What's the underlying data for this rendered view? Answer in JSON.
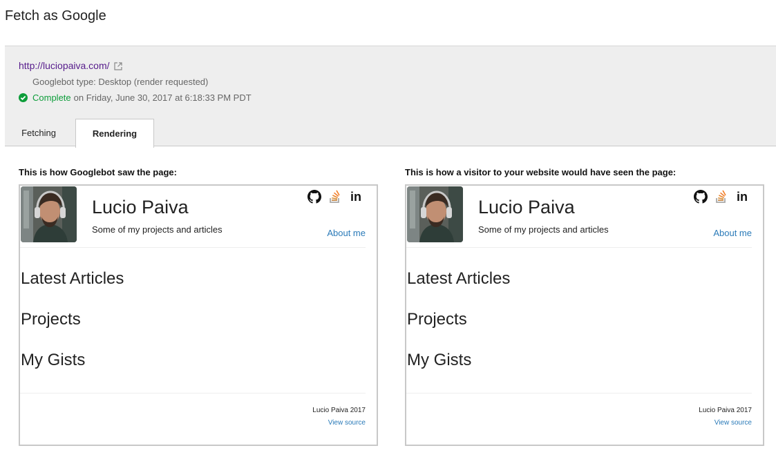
{
  "header": {
    "title": "Fetch as Google"
  },
  "fetch": {
    "url": "http://luciopaiva.com/",
    "bot_type": "Googlebot type: Desktop (render requested)",
    "status": "Complete",
    "status_date": "on Friday, June 30, 2017 at 6:18:33 PM PDT"
  },
  "tabs": [
    {
      "label": "Fetching",
      "active": false
    },
    {
      "label": "Rendering",
      "active": true
    }
  ],
  "captions": {
    "googlebot": "This is how Googlebot saw the page:",
    "visitor": "This is how a visitor to your website would have seen the page:"
  },
  "site": {
    "name": "Lucio Paiva",
    "tagline": "Some of my projects and articles",
    "about": "About me",
    "sections": [
      "Latest Articles",
      "Projects",
      "My Gists"
    ],
    "footer_name": "Lucio Paiva 2017",
    "view_source": "View source",
    "social_icons": [
      "github-icon",
      "stackoverflow-icon",
      "linkedin-icon"
    ],
    "social_linkedin_text": "in"
  },
  "colors": {
    "visited_link": "#551a8b",
    "complete_green": "#0d9d3a",
    "site_link_blue": "#2a7ab8",
    "panel_bg": "#eeeeee"
  }
}
